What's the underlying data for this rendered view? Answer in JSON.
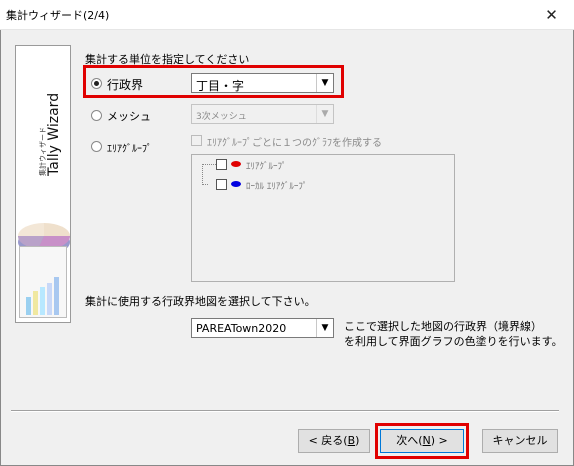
{
  "window": {
    "title": "集計ウィザード(2/4)",
    "close_glyph": "✕"
  },
  "side": {
    "subtitle": "集計ウィザード",
    "title": "Tally Wizard"
  },
  "unit_section": {
    "heading": "集計する単位を指定してください",
    "options": [
      {
        "label": "行政界",
        "selected": true,
        "combo_value": "丁目・字",
        "combo_enabled": true
      },
      {
        "label": "メッシュ",
        "selected": false,
        "combo_value": "3次メッシュ",
        "combo_enabled": false
      },
      {
        "label": "ｴﾘｱｸﾞﾙｰﾌﾟ",
        "selected": false
      }
    ],
    "per_group_checkbox": "ｴﾘｱｸﾞﾙｰﾌﾟごとに１つのｸﾞﾗﾌを作成する",
    "tree": [
      {
        "label": "ｴﾘｱｸﾞﾙｰﾌﾟ",
        "color": "#e00000"
      },
      {
        "label": "ﾛｰｶﾙ ｴﾘｱｸﾞﾙｰﾌﾟ",
        "color": "#0000e0"
      }
    ]
  },
  "map_section": {
    "heading": "集計に使用する行政界地図を選択して下さい。",
    "combo_value": "PAREATown2020",
    "note_line1": "ここで選択した地図の行政界（境界線）",
    "note_line2": "を利用して界面グラフの色塗りを行います。"
  },
  "buttons": {
    "back_prefix": "< 戻る(",
    "back_key": "B",
    "back_suffix": ")",
    "next_prefix": "次へ(",
    "next_key": "N",
    "next_suffix": ") >",
    "cancel": "キャンセル"
  }
}
